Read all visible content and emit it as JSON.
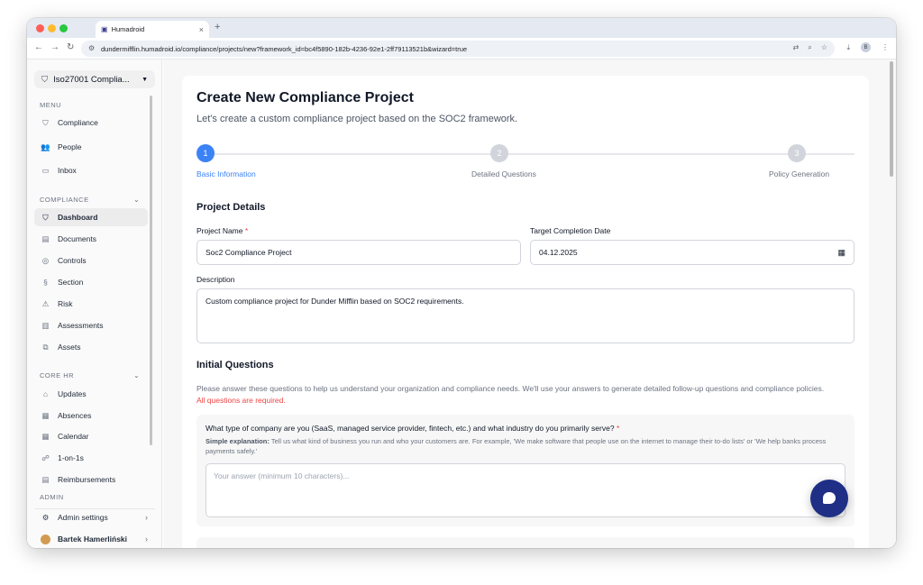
{
  "browser": {
    "tab_title": "Humadroid",
    "tab_close": "×",
    "new_tab": "+",
    "url": "dundermifflin.humadroid.io/compliance/projects/new?framework_id=bc4f5890-182b-4236-92e1-2ff79113521b&wizard=true",
    "profile_initial": "B",
    "colors": {
      "close": "#ff5f57",
      "minimize": "#febc2e",
      "maximize": "#28c840"
    }
  },
  "sidebar": {
    "org_name": "Iso27001 Complia...",
    "menu_heading": "MENU",
    "menu_items": [
      {
        "label": "Compliance",
        "icon": "shield-icon"
      },
      {
        "label": "People",
        "icon": "people-icon"
      },
      {
        "label": "Inbox",
        "icon": "inbox-icon"
      }
    ],
    "compliance_heading": "COMPLIANCE",
    "compliance_items": [
      {
        "label": "Dashboard",
        "icon": "shield-icon",
        "active": true
      },
      {
        "label": "Documents",
        "icon": "documents-icon"
      },
      {
        "label": "Controls",
        "icon": "controls-icon"
      },
      {
        "label": "Section",
        "icon": "section-icon"
      },
      {
        "label": "Risk",
        "icon": "warning-icon"
      },
      {
        "label": "Assessments",
        "icon": "clipboard-icon"
      },
      {
        "label": "Assets",
        "icon": "assets-icon"
      }
    ],
    "corehr_heading": "CORE HR",
    "corehr_items": [
      {
        "label": "Updates",
        "icon": "home-icon"
      },
      {
        "label": "Absences",
        "icon": "calendar-icon"
      },
      {
        "label": "Calendar",
        "icon": "calendar-icon"
      },
      {
        "label": "1-on-1s",
        "icon": "chat-icon"
      },
      {
        "label": "Reimbursements",
        "icon": "receipt-icon"
      }
    ],
    "admin_heading": "ADMIN",
    "admin_settings": "Admin settings",
    "user_name": "Bartek Hamerliński"
  },
  "main": {
    "title": "Create New Compliance Project",
    "subtitle": "Let's create a custom compliance project based on the SOC2 framework.",
    "steps": [
      {
        "number": "1",
        "label": "Basic Information",
        "active": true
      },
      {
        "number": "2",
        "label": "Detailed Questions",
        "active": false
      },
      {
        "number": "3",
        "label": "Policy Generation",
        "active": false
      }
    ],
    "project_details_heading": "Project Details",
    "project_name_label": "Project Name",
    "required_mark": "*",
    "project_name_value": "Soc2 Compliance Project",
    "target_date_label": "Target Completion Date",
    "target_date_value": "04.12.2025",
    "description_label": "Description",
    "description_value": "Custom compliance project for Dunder Mifflin based on SOC2 requirements.",
    "initial_questions_heading": "Initial Questions",
    "intro_text": "Please answer these questions to help us understand your organization and compliance needs. We'll use your answers to generate detailed follow-up questions and compliance policies.",
    "intro_required": "All questions are required.",
    "question1": {
      "title": "What type of company are you (SaaS, managed service provider, fintech, etc.) and what industry do you primarily serve?",
      "explanation_label": "Simple explanation:",
      "explanation": "Tell us what kind of business you run and who your customers are. For example, 'We make software that people use on the internet to manage their to-do lists' or 'We help banks process payments safely.'",
      "placeholder": "Your answer (minimum 10 characters)..."
    }
  },
  "accent_color": "#3b82f6",
  "chat_button_color": "#1f2f86"
}
